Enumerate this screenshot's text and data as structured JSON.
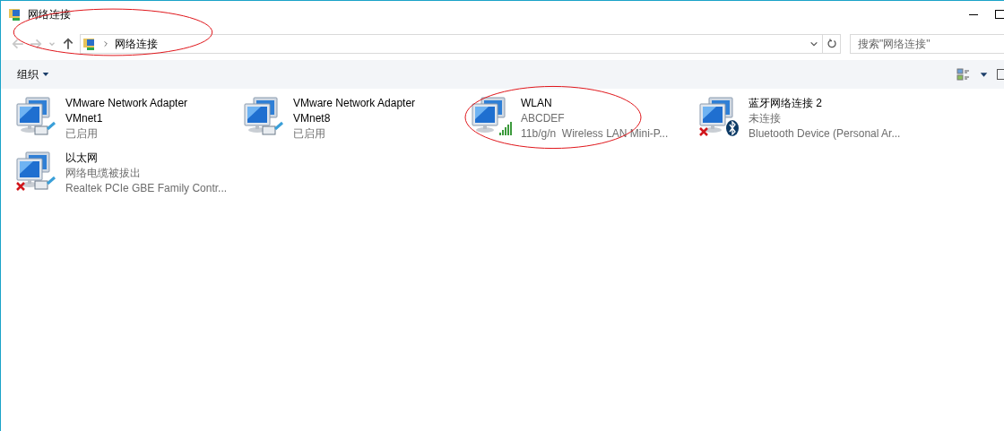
{
  "window": {
    "title": "网络连接",
    "circled": true
  },
  "address": {
    "path": [
      "网络连接"
    ]
  },
  "search": {
    "placeholder": "搜索\"网络连接\""
  },
  "toolbar": {
    "organize": "组织"
  },
  "connections": [
    {
      "kind": "ethernet",
      "disconnected": false,
      "circled": false,
      "name_lines": [
        "VMware Network Adapter",
        "VMnet1"
      ],
      "details": [
        "已启用"
      ]
    },
    {
      "kind": "ethernet",
      "disconnected": false,
      "circled": false,
      "name_lines": [
        "VMware Network Adapter",
        "VMnet8"
      ],
      "details": [
        "已启用"
      ]
    },
    {
      "kind": "wifi",
      "disconnected": false,
      "circled": true,
      "name_lines": [
        "WLAN"
      ],
      "details": [
        "ABCDEF",
        "11b/g/n  Wireless LAN Mini-P..."
      ]
    },
    {
      "kind": "bluetooth",
      "disconnected": true,
      "circled": false,
      "name_lines": [
        "蓝牙网络连接 2"
      ],
      "details": [
        "未连接",
        "Bluetooth Device (Personal Ar..."
      ]
    },
    {
      "kind": "ethernet",
      "disconnected": true,
      "circled": false,
      "name_lines": [
        "以太网"
      ],
      "details": [
        "网络电缆被拔出",
        "Realtek PCIe GBE Family Contr..."
      ]
    }
  ]
}
